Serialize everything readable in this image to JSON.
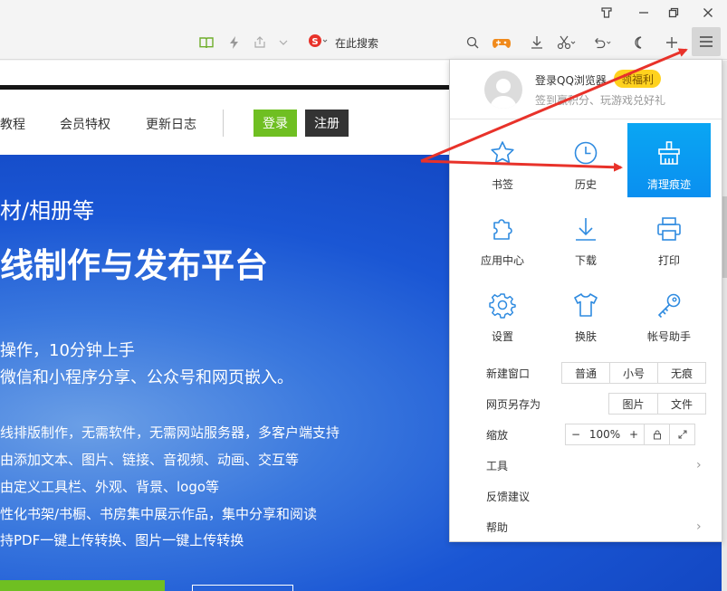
{
  "toolbar": {
    "search_text": "在此搜索"
  },
  "site_nav": {
    "links": [
      "教程",
      "会员特权",
      "更新日志"
    ],
    "login": "登录",
    "register": "注册"
  },
  "hero": {
    "title1": "材/相册等",
    "title2": "线制作与发布平台",
    "sub1": "操作，10分钟上手",
    "sub2": "微信和小程序分享、公众号和网页嵌入。",
    "features": [
      "线排版制作，无需软件，无需网站服务器，多客户端支持",
      "由添加文本、图片、链接、音视频、动画、交互等",
      "由定义工具栏、外观、背景、logo等",
      "性化书架/书橱、书房集中展示作品，集中分享和阅读",
      "持PDF一键上传转换、图片一键上传转换"
    ]
  },
  "menu": {
    "login_label": "登录QQ浏览器",
    "welfare_badge": "领福利",
    "login_sub": "签到赢积分、玩游戏兑好礼",
    "grid": [
      {
        "label": "书签",
        "icon": "star-icon"
      },
      {
        "label": "历史",
        "icon": "clock-icon"
      },
      {
        "label": "清理痕迹",
        "icon": "broom-icon"
      },
      {
        "label": "应用中心",
        "icon": "puzzle-icon"
      },
      {
        "label": "下载",
        "icon": "download-icon"
      },
      {
        "label": "打印",
        "icon": "printer-icon"
      },
      {
        "label": "设置",
        "icon": "gear-icon"
      },
      {
        "label": "换肤",
        "icon": "tshirt-icon"
      },
      {
        "label": "帐号助手",
        "icon": "key-icon"
      }
    ],
    "new_window": {
      "label": "新建窗口",
      "options": [
        "普通",
        "小号",
        "无痕"
      ]
    },
    "save_as": {
      "label": "网页另存为",
      "options": [
        "图片",
        "文件"
      ]
    },
    "zoom": {
      "label": "缩放",
      "minus": "−",
      "value": "100%",
      "plus": "+"
    },
    "tools": "工具",
    "feedback": "反馈建议",
    "help": "帮助"
  },
  "colors": {
    "accent_blue": "#0a97f2",
    "icon_blue": "#2f8be0",
    "login_green": "#6fbf22",
    "badge_yellow": "#ffd21e",
    "arrow_red": "#e8322a"
  }
}
